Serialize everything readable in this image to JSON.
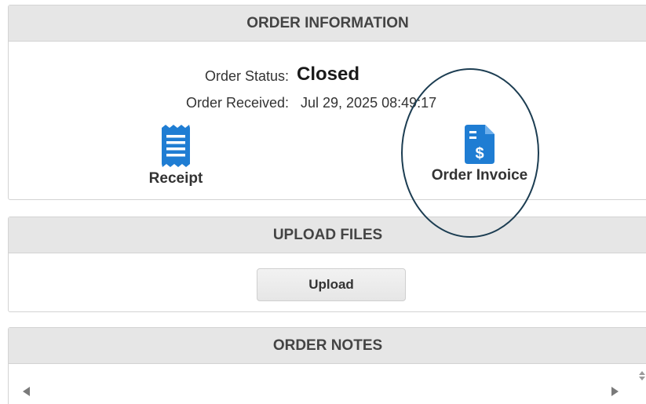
{
  "order_info": {
    "title": "ORDER INFORMATION",
    "status_label": "Order Status:",
    "status_value": "Closed",
    "received_label": "Order Received:",
    "received_value": "Jul 29, 2025 08:49:17",
    "receipt_label": "Receipt",
    "receipt_icon": "receipt-icon",
    "invoice_label": "Order Invoice",
    "invoice_icon": "invoice-dollar-icon"
  },
  "upload": {
    "title": "UPLOAD FILES",
    "button_label": "Upload"
  },
  "notes": {
    "title": "ORDER NOTES"
  },
  "colors": {
    "icon_blue": "#1f7dd3",
    "header_bg": "#e6e6e6",
    "annotation": "#1c3d52"
  }
}
